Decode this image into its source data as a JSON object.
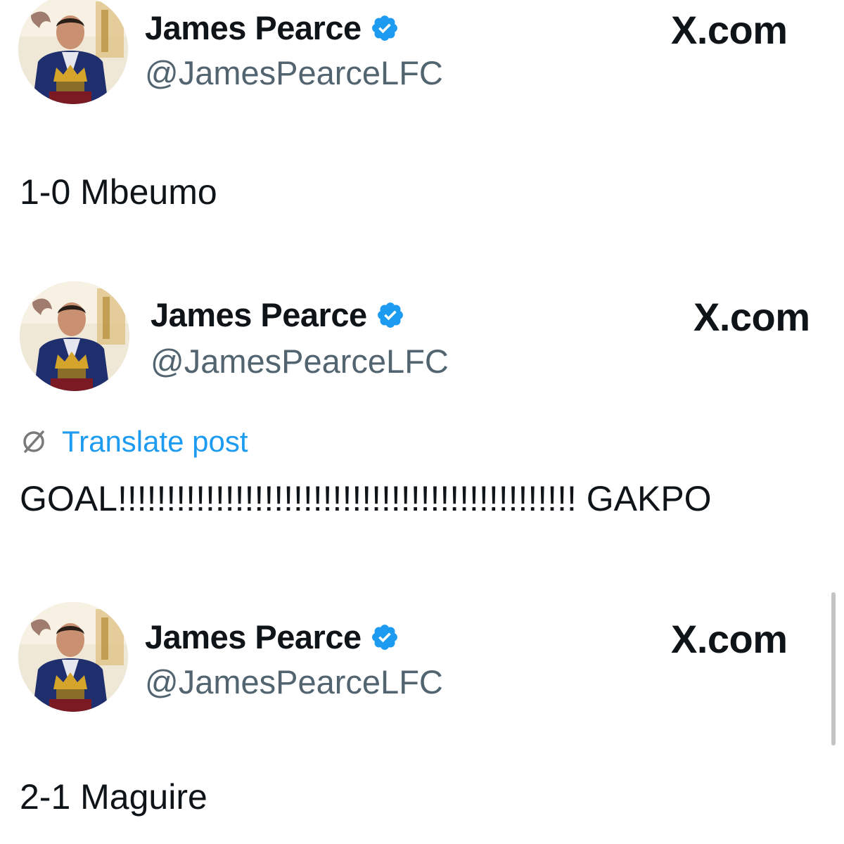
{
  "posts": [
    {
      "author": {
        "display_name": "James Pearce",
        "handle": "@JamesPearceLFC",
        "verified_icon": "verified-badge-icon"
      },
      "brand": "X.com",
      "text": "1-0 Mbeumo"
    },
    {
      "author": {
        "display_name": "James Pearce",
        "handle": "@JamesPearceLFC",
        "verified_icon": "verified-badge-icon"
      },
      "brand": "X.com",
      "translate_label": "Translate post",
      "translate_icon": "translate-icon",
      "text": "GOAL!!!!!!!!!!!!!!!!!!!!!!!!!!!!!!!!!!!!!!!!!!!!!!! GAKPO"
    },
    {
      "author": {
        "display_name": "James Pearce",
        "handle": "@JamesPearceLFC",
        "verified_icon": "verified-badge-icon"
      },
      "brand": "X.com",
      "text": "2-1 Maguire"
    }
  ],
  "colors": {
    "text_primary": "#0f1419",
    "text_secondary": "#536471",
    "accent_blue": "#1d9bf0"
  }
}
